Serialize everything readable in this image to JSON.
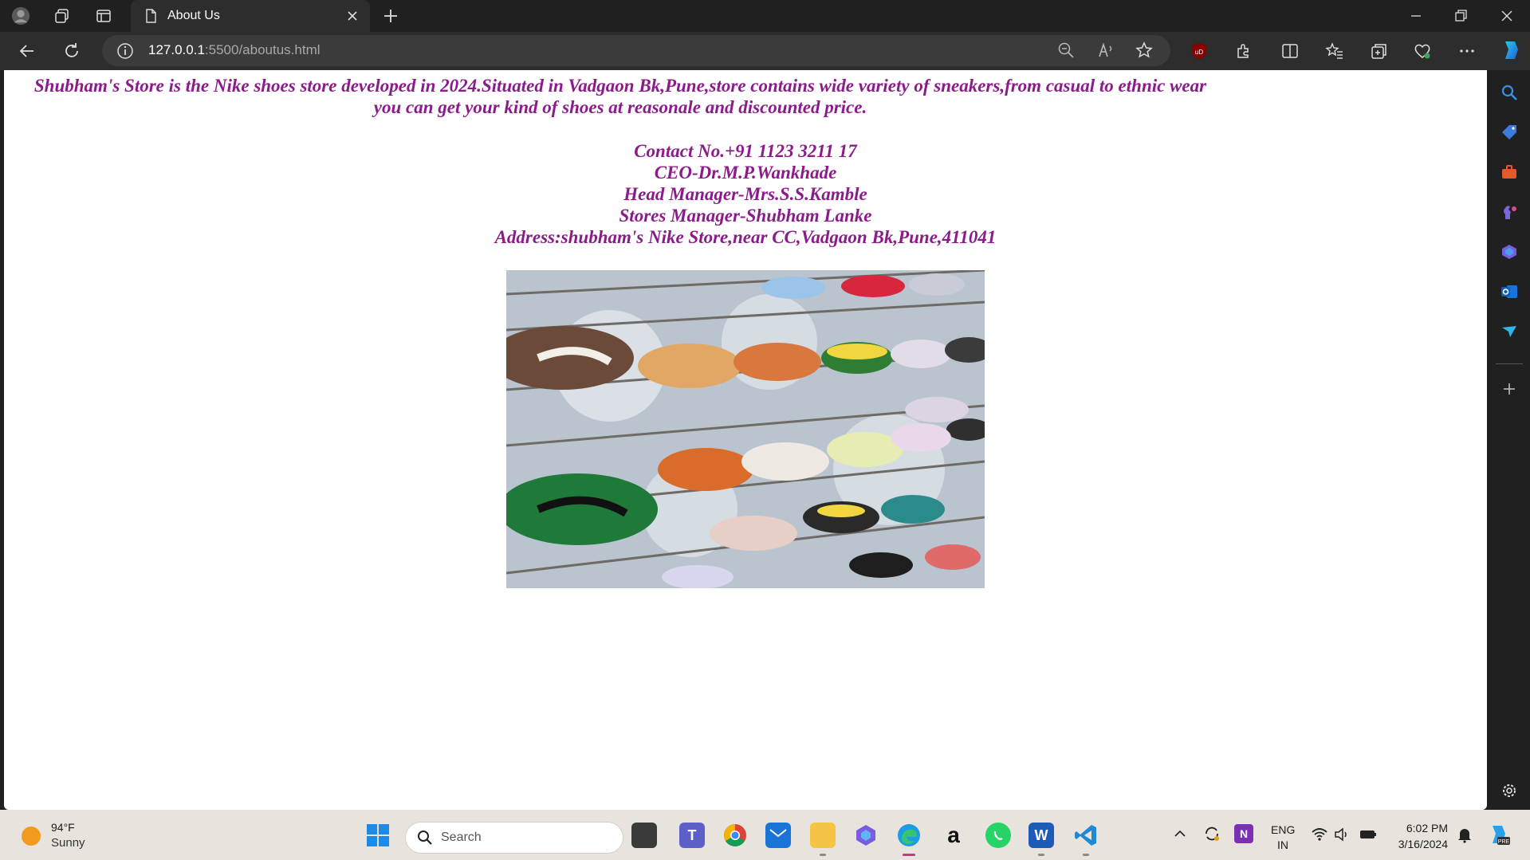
{
  "browser": {
    "tab_title": "About Us",
    "url_host": "127.0.0.1",
    "url_rest": ":5500/aboutus.html"
  },
  "page": {
    "intro_line1": "Shubham's Store is the Nike shoes store developed in 2024.Situated in Vadgaon Bk,Pune,store contains wide variety of sneakers,from casual to ethnic wear",
    "intro_line2": "you can get your kind of shoes at reasonale and discounted price.",
    "contact_lines": [
      "Contact No.+91 1123 3211 17",
      "CEO-Dr.M.P.Wankhade",
      "Head Manager-Mrs.S.S.Kamble",
      "Stores Manager-Shubham Lanke",
      "Address:shubham's Nike Store,near CC,Vadgaon Bk,Pune,411041"
    ],
    "text_color": "#8b1a8b"
  },
  "taskbar": {
    "weather_temp": "94°F",
    "weather_condition": "Sunny",
    "search_label": "Search",
    "lang_line1": "ENG",
    "lang_line2": "IN",
    "time": "6:02 PM",
    "date": "3/16/2024"
  },
  "colors": {
    "browser_bg": "#202020",
    "toolbar_bg": "#2d2d2d",
    "taskbar_bg": "#e8e3dd"
  }
}
